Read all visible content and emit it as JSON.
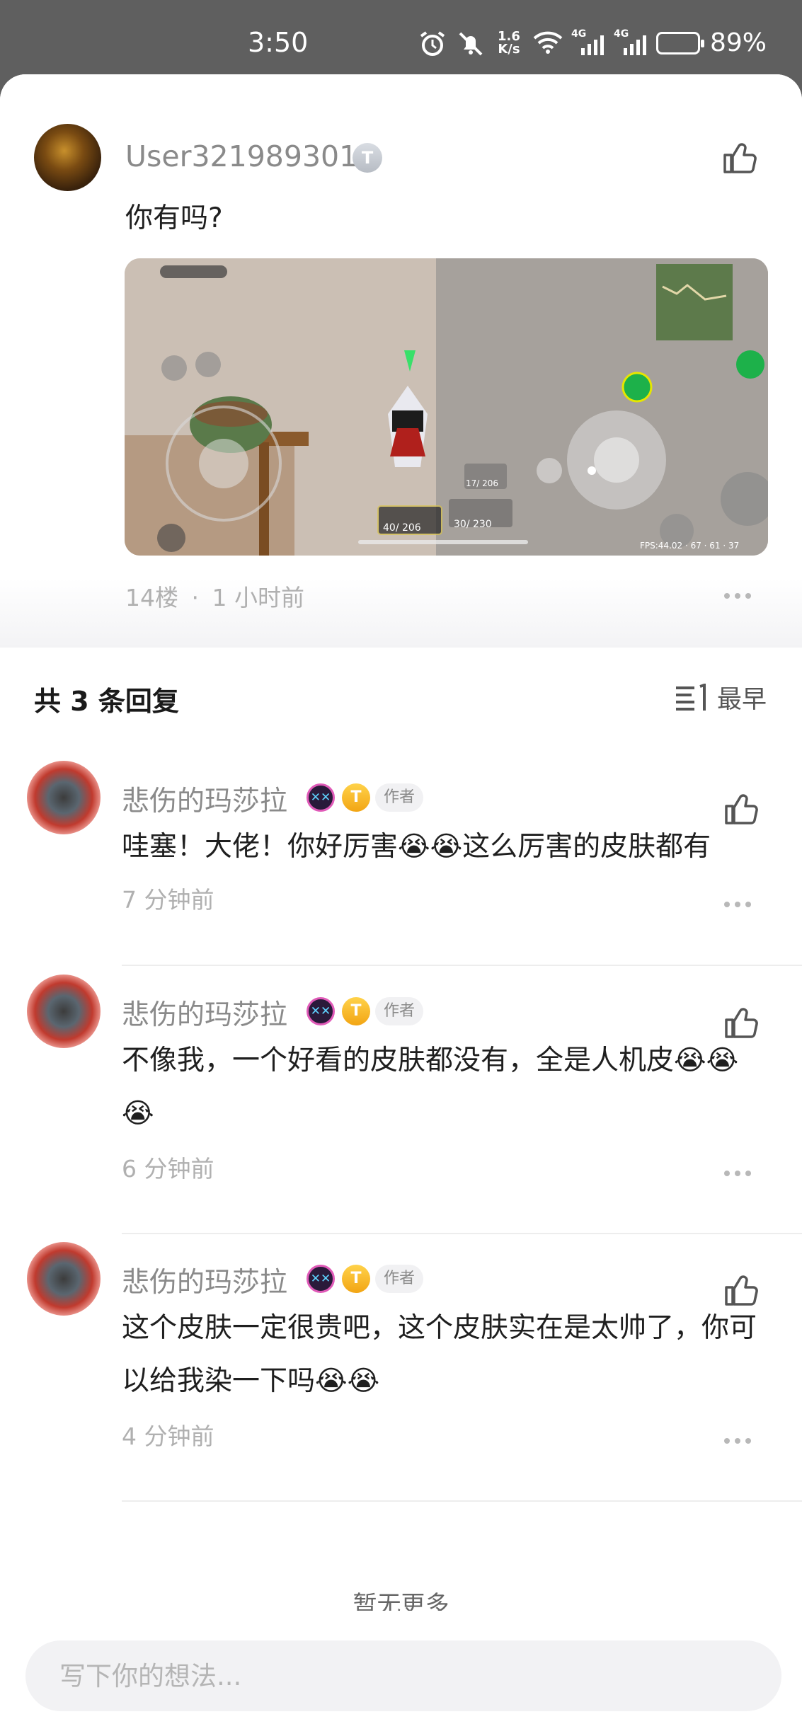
{
  "status_bar": {
    "time": "3:50",
    "speed_top": "1.6",
    "speed_unit": "K/s",
    "signal1_tag": "4G",
    "signal2_tag": "4G",
    "battery": "89%"
  },
  "main_comment": {
    "username": "User321989301",
    "level_badge": "T",
    "text": "你有吗?",
    "floor": "14楼",
    "separator": "·",
    "time": "1 小时前",
    "image_alt": "game-screenshot",
    "game_hud": {
      "ammo_main": "40/ 206",
      "ammo_secondary": "30/ 230",
      "ammo_pistol": "17/ 206",
      "fps": "FPS:44.02 · 67 · 61 · 37"
    }
  },
  "replies_section": {
    "title": "共 3 条回复",
    "sort_label": "最早",
    "replies": [
      {
        "name": "悲伤的玛莎拉",
        "badge": "T",
        "tag": "作者",
        "text": "哇塞！大佬！你好厉害😭😭这么厉害的皮肤都有",
        "time": "7 分钟前"
      },
      {
        "name": "悲伤的玛莎拉",
        "badge": "T",
        "tag": "作者",
        "text": "不像我，一个好看的皮肤都没有，全是人机皮😭😭😭",
        "time": "6 分钟前"
      },
      {
        "name": "悲伤的玛莎拉",
        "badge": "T",
        "tag": "作者",
        "text": "这个皮肤一定很贵吧，这个皮肤实在是太帅了，你可以给我染一下吗😭😭",
        "time": "4 分钟前"
      }
    ],
    "end_note": "暂无更多"
  },
  "input": {
    "placeholder": "写下你的想法..."
  },
  "colors": {
    "status_bg": "#5f5f5f",
    "sheet_bg": "#ffffff",
    "secondary_text": "#8a8a8a",
    "meta_text": "#b0b0b0"
  },
  "icons": {
    "like": "thumbs-up-icon",
    "more": "more-dots-icon",
    "sort": "sort-list-icon"
  }
}
